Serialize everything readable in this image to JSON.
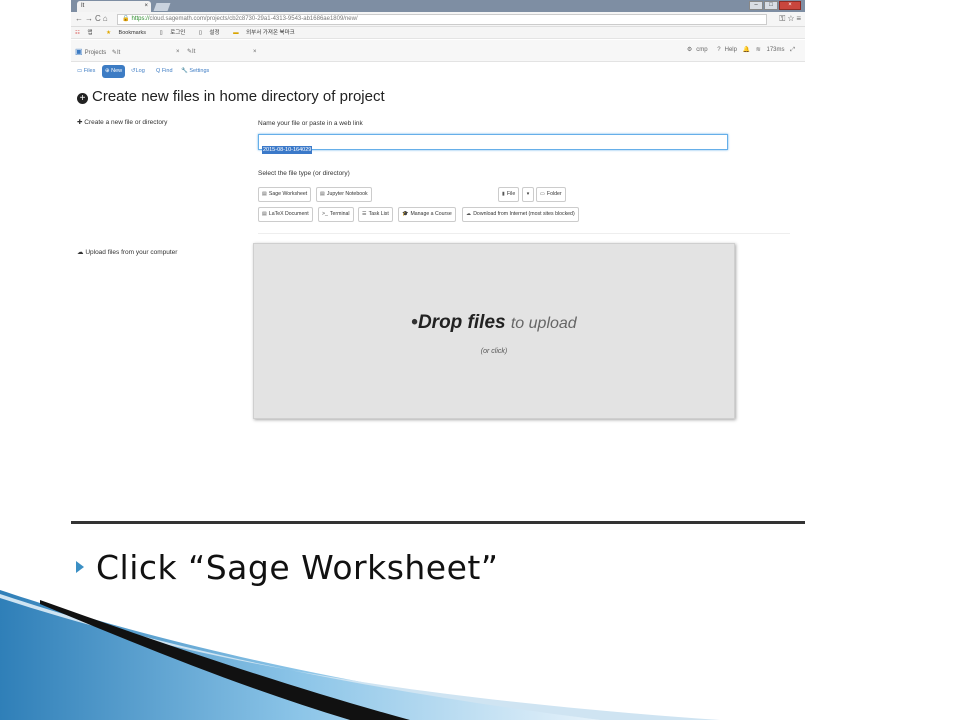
{
  "browser": {
    "tab_title": "It",
    "url_scheme": "https://",
    "url_rest": "cloud.sagemath.com/projects/cb2c8730-29a1-4313-9543-ab1686ae1809/new/",
    "bookmarks": [
      "앱",
      "Bookmarks",
      "로그인",
      "설정",
      "외부서 가져온 북마크"
    ]
  },
  "app": {
    "tabs": [
      {
        "label": "Projects"
      },
      {
        "label": "It"
      },
      {
        "label": "It"
      }
    ],
    "status": {
      "cmp": "cmp",
      "help": "Help",
      "ping": "173ms"
    },
    "subnav": {
      "files": "Files",
      "new": "New",
      "log": "Log",
      "find": "Find",
      "settings": "Settings"
    },
    "heading": "Create new files in home directory of project",
    "create_label": "Create a new file or directory",
    "name_label": "Name your file or paste in a web link",
    "file_name_value": "2015-08-10-164029",
    "type_label": "Select the file type (or directory)",
    "buttons": {
      "sage_worksheet": "Sage Worksheet",
      "jupyter_notebook": "Jupyter Notebook",
      "file": "File",
      "folder": "Folder",
      "latex_document": "LaTeX Document",
      "terminal": "Terminal",
      "task_list": "Task List",
      "manage_course": "Manage a Course",
      "download_internet": "Download from Internet (most sites blocked)"
    },
    "upload_label": "Upload files from your computer",
    "dropzone": {
      "bold": "Drop files",
      "light": "to upload",
      "sub": "(or click)"
    }
  },
  "slide": {
    "caption": "Click “Sage Worksheet”"
  },
  "colors": {
    "accent": "#3d7cc4",
    "swoosh_dark": "#111111",
    "swoosh_blue": "#4a9fd4"
  }
}
